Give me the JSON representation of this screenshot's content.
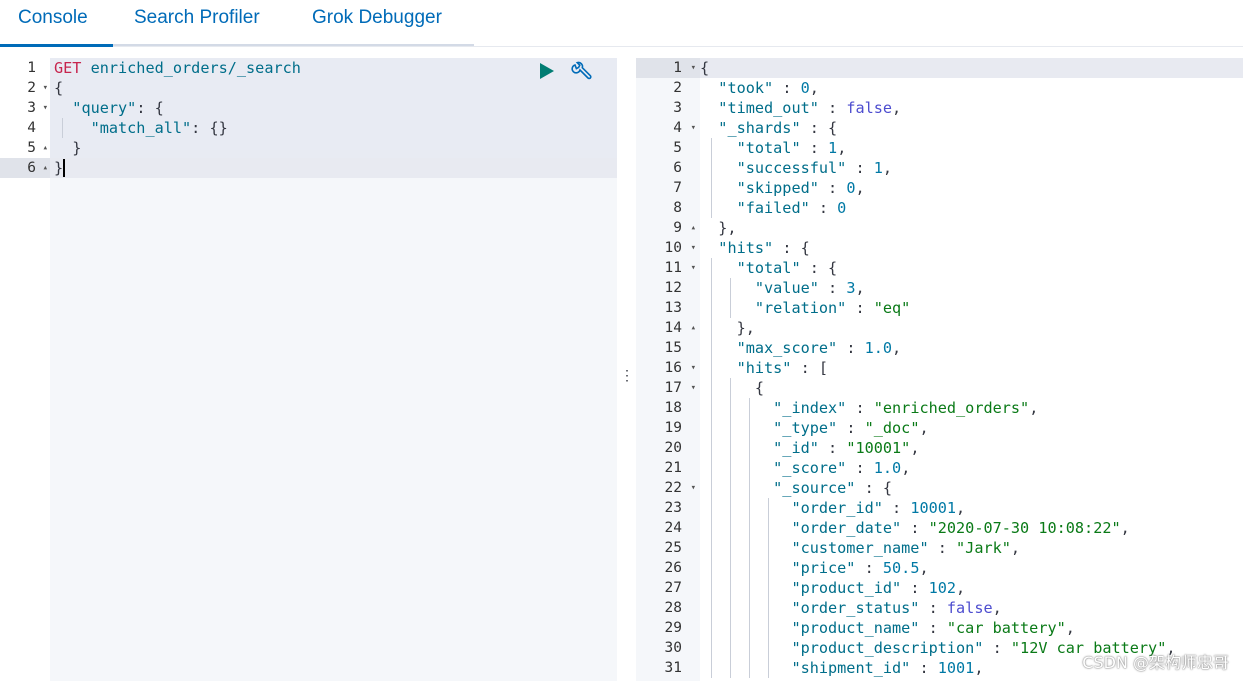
{
  "tabs": [
    {
      "label": "Console",
      "active": true
    },
    {
      "label": "Search Profiler",
      "active": false
    },
    {
      "label": "Grok Debugger",
      "active": false
    }
  ],
  "request": {
    "method": "GET",
    "path": "enriched_orders/_search",
    "lines": [
      {
        "num": "1",
        "fold": ""
      },
      {
        "num": "2",
        "fold": "▾"
      },
      {
        "num": "3",
        "fold": "▾"
      },
      {
        "num": "4",
        "fold": ""
      },
      {
        "num": "5",
        "fold": "▴"
      },
      {
        "num": "6",
        "fold": "▴"
      }
    ],
    "run_icon": "play-icon",
    "settings_icon": "wrench-icon"
  },
  "response": {
    "line_numbers": [
      "1",
      "2",
      "3",
      "4",
      "5",
      "6",
      "7",
      "8",
      "9",
      "10",
      "11",
      "12",
      "13",
      "14",
      "15",
      "16",
      "17",
      "18",
      "19",
      "20",
      "21",
      "22",
      "23",
      "24",
      "25",
      "26",
      "27",
      "28",
      "29",
      "30",
      "31"
    ],
    "folds": {
      "1": "▾",
      "4": "▾",
      "9": "▴",
      "10": "▾",
      "11": "▾",
      "14": "▴",
      "16": "▾",
      "17": "▾",
      "22": "▾"
    },
    "took": "0",
    "timed_out": "false",
    "shards": {
      "total": "1",
      "successful": "1",
      "skipped": "0",
      "failed": "0"
    },
    "hits_total_value": "3",
    "hits_total_relation": "\"eq\"",
    "max_score": "1.0",
    "hit": {
      "_index": "\"enriched_orders\"",
      "_type": "\"_doc\"",
      "_id": "\"10001\"",
      "_score": "1.0",
      "source": {
        "order_id": "10001",
        "order_date": "\"2020-07-30 10:08:22\"",
        "customer_name": "\"Jark\"",
        "price": "50.5",
        "product_id": "102",
        "order_status": "false",
        "product_name": "\"car battery\"",
        "product_description": "\"12V car battery\"",
        "shipment_id": "1001"
      }
    }
  },
  "watermark": "CSDN @架构师忠哥",
  "resizer_icon": "vertical-dots-icon"
}
